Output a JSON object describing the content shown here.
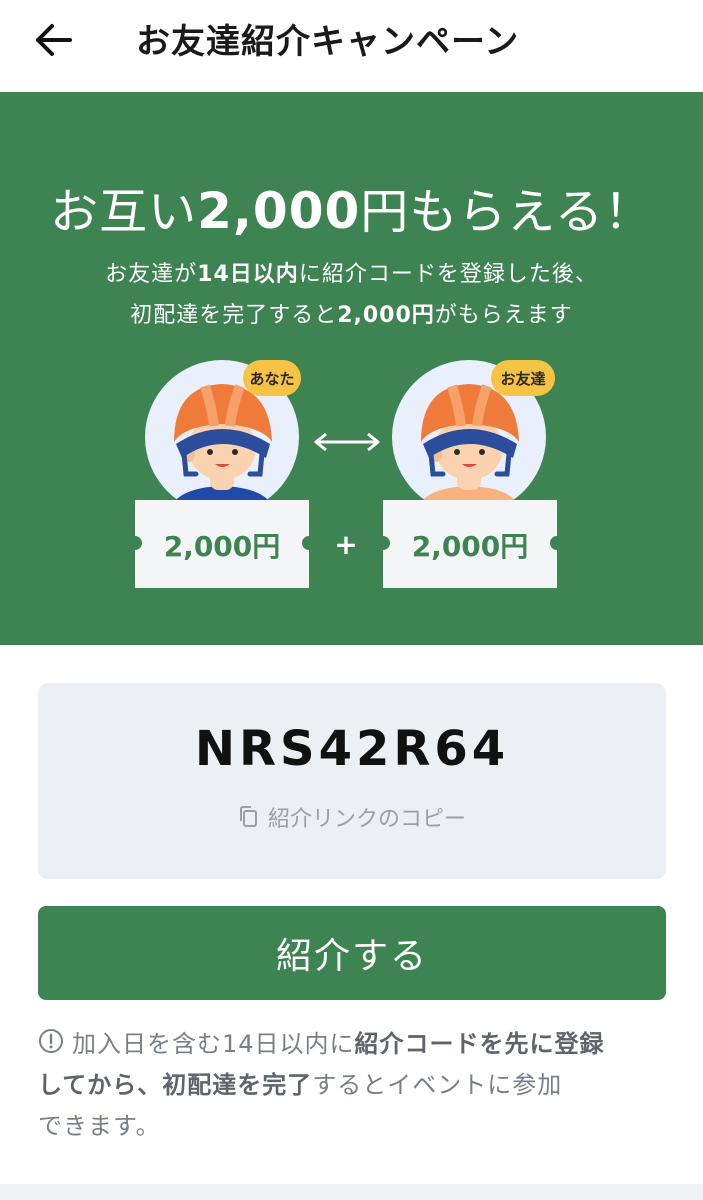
{
  "header": {
    "back_icon": "arrow-left-icon",
    "title": "お友達紹介キャンペーン"
  },
  "hero": {
    "headline_pre": "お互い",
    "headline_amount": "2,000",
    "headline_post": "円もらえる！",
    "sub1_pre": "お友達が",
    "sub1_bold": "14日以内",
    "sub1_post": "に紹介コードを登録した後、",
    "sub2_pre": "初配達を完了すると",
    "sub2_bold": "2,000円",
    "sub2_post": "がもらえます",
    "you_badge": "あなた",
    "friend_badge": "お友達",
    "you_reward": "2,000円",
    "friend_reward": "2,000円",
    "plus": "+",
    "colors": {
      "background": "#3e8352",
      "badge": "#f6c344",
      "helmet": "#ef7a3a",
      "skin": "#fbd2b0",
      "ticket": "#f4f5f6"
    }
  },
  "code_card": {
    "code": "NRS42R64",
    "copy_icon": "copy-icon",
    "copy_label": "紹介リンクのコピー"
  },
  "cta": {
    "label": "紹介する"
  },
  "notice": {
    "icon": "info-circle-icon",
    "t1": "加入日を含む14日以内に",
    "b1": "紹介コードを先に登録",
    "b2": "してから、初配達を完了",
    "t2": "するとイベントに参加",
    "t3": "できます。"
  }
}
